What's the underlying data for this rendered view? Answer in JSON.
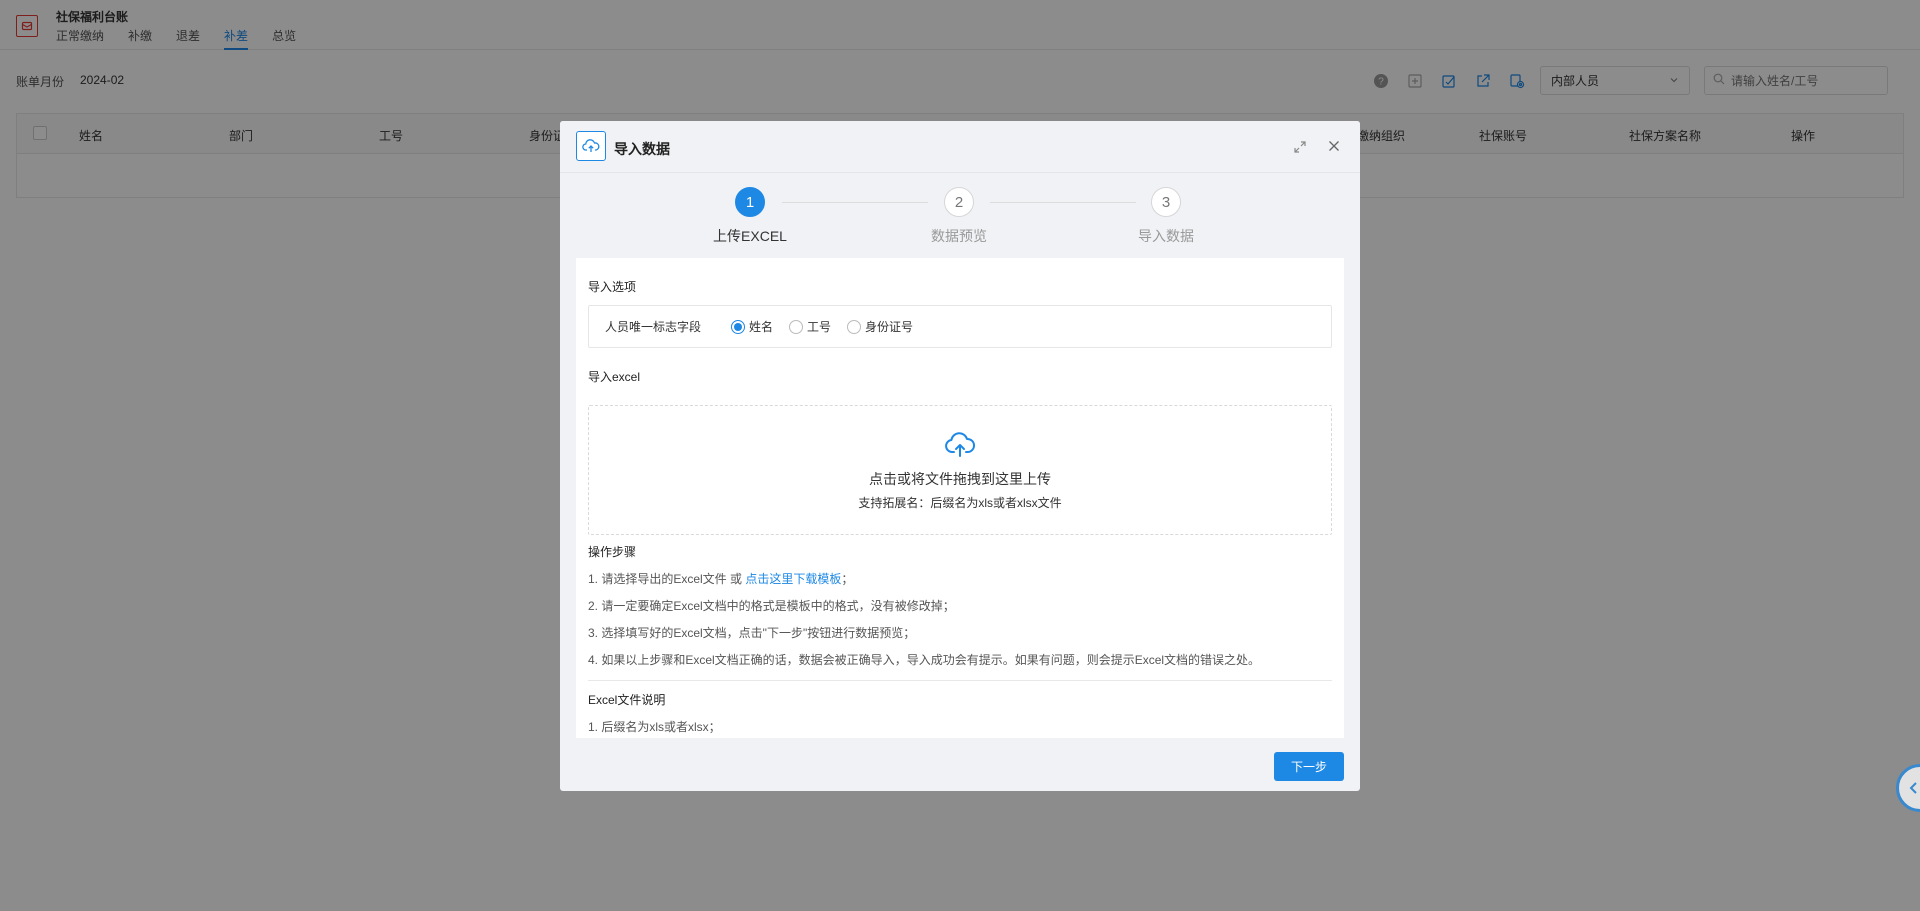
{
  "app": {
    "title": "社保福利台账",
    "tabs": [
      "正常缴纳",
      "补缴",
      "退差",
      "补差",
      "总览"
    ],
    "active_tab": 3
  },
  "filter": {
    "label": "账单月份",
    "value": "2024-02"
  },
  "toolbar": {
    "icons": [
      "help-icon",
      "add-icon",
      "edit-icon",
      "export-icon",
      "settings-icon"
    ]
  },
  "staff_select": {
    "value": "内部人员"
  },
  "search": {
    "placeholder": "请输入姓名/工号"
  },
  "table": {
    "columns": [
      "姓名",
      "部门",
      "工号",
      "身份证",
      "缴纳组织",
      "社保账号",
      "社保方案名称",
      "操作"
    ]
  },
  "modal": {
    "title": "导入数据",
    "steps": [
      {
        "number": "1",
        "label": "上传EXCEL"
      },
      {
        "number": "2",
        "label": "数据预览"
      },
      {
        "number": "3",
        "label": "导入数据"
      }
    ],
    "active_step": 0,
    "import_options": {
      "title": "导入选项",
      "field_label": "人员唯一标志字段",
      "radios": [
        "姓名",
        "工号",
        "身份证号"
      ],
      "selected": 0
    },
    "import_excel": {
      "title": "导入excel",
      "upload_main": "点击或将文件拖拽到这里上传",
      "upload_sub": "支持拓展名：后缀名为xls或者xlsx文件"
    },
    "operation_steps": {
      "title": "操作步骤",
      "item1_prefix": "1. 请选择导出的Excel文件 或 ",
      "item1_link": "点击这里下载模板",
      "item1_suffix": "；",
      "item2": "2. 请一定要确定Excel文档中的格式是模板中的格式，没有被修改掉；",
      "item3": "3. 选择填写好的Excel文档，点击\"下一步\"按钮进行数据预览；",
      "item4": "4. 如果以上步骤和Excel文档正确的话，数据会被正确导入，导入成功会有提示。如果有问题，则会提示Excel文档的错误之处。"
    },
    "excel_notes": {
      "title": "Excel文件说明",
      "item1": "1. 后缀名为xls或者xlsx；"
    },
    "next_button": "下一步"
  },
  "colors": {
    "accent": "#1e88e5",
    "danger": "#e53935"
  }
}
